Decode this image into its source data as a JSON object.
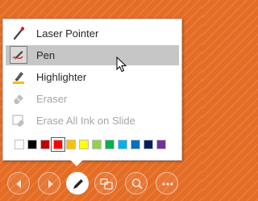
{
  "menu": {
    "items": [
      {
        "label": "Laser Pointer",
        "icon": "laser-pointer-icon",
        "disabled": false
      },
      {
        "label": "Pen",
        "icon": "pen-icon",
        "disabled": false,
        "hovered": true,
        "checked": true
      },
      {
        "label": "Highlighter",
        "icon": "highlighter-icon",
        "disabled": false
      },
      {
        "label": "Eraser",
        "icon": "eraser-icon",
        "disabled": true
      },
      {
        "label": "Erase All Ink on Slide",
        "icon": "erase-all-ink-icon",
        "disabled": true
      }
    ],
    "colors": [
      "#ffffff",
      "#000000",
      "#c00000",
      "#ff0000",
      "#ffc000",
      "#ffff00",
      "#92d050",
      "#00b050",
      "#00b0f0",
      "#0070c0",
      "#002060",
      "#7030a0"
    ],
    "selected_color": "#ff0000"
  },
  "toolbar": {
    "buttons": [
      {
        "name": "previous-slide-button",
        "icon": "arrow-left-icon"
      },
      {
        "name": "next-slide-button",
        "icon": "arrow-right-icon"
      },
      {
        "name": "pen-tool-button",
        "icon": "pen-icon",
        "active": true
      },
      {
        "name": "see-all-slides-button",
        "icon": "slides-grid-icon"
      },
      {
        "name": "zoom-button",
        "icon": "magnifier-icon"
      },
      {
        "name": "more-options-button",
        "icon": "ellipsis-icon"
      }
    ]
  },
  "theme": {
    "background": "#e36c26",
    "hover_row": "#c6c6c6",
    "disabled_text": "#a6a6a6"
  }
}
